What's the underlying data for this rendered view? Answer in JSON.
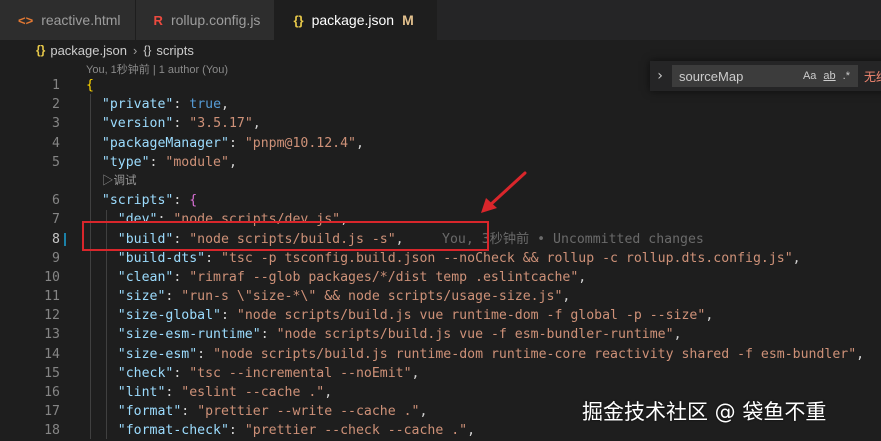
{
  "tabs": [
    {
      "icon": "<>",
      "label": "reactive.html",
      "active": false
    },
    {
      "icon": "R",
      "label": "rollup.config.js",
      "active": false
    },
    {
      "icon": "{}",
      "label": "package.json",
      "modified": "M",
      "active": true
    }
  ],
  "breadcrumb": {
    "file": "package.json",
    "symbol": "scripts",
    "file_icon": "{}",
    "symbol_icon": "{}"
  },
  "blame_header": "You, 1秒钟前 | 1 author (You)",
  "codelens_debug": "▷调试",
  "inline_blame": "You, 3秒钟前 • Uncommitted changes",
  "lines": [
    {
      "n": "1",
      "t": [
        [
          "br",
          "{"
        ]
      ]
    },
    {
      "n": "2",
      "t": [
        [
          "p",
          "  "
        ],
        [
          "k",
          "\"private\""
        ],
        [
          "p",
          ": "
        ],
        [
          "b",
          "true"
        ],
        [
          "p",
          ","
        ]
      ]
    },
    {
      "n": "3",
      "t": [
        [
          "p",
          "  "
        ],
        [
          "k",
          "\"version\""
        ],
        [
          "p",
          ": "
        ],
        [
          "s",
          "\"3.5.17\""
        ],
        [
          "p",
          ","
        ]
      ]
    },
    {
      "n": "4",
      "t": [
        [
          "p",
          "  "
        ],
        [
          "k",
          "\"packageManager\""
        ],
        [
          "p",
          ": "
        ],
        [
          "s",
          "\"pnpm@10.12.4\""
        ],
        [
          "p",
          ","
        ]
      ]
    },
    {
      "n": "5",
      "t": [
        [
          "p",
          "  "
        ],
        [
          "k",
          "\"type\""
        ],
        [
          "p",
          ": "
        ],
        [
          "s",
          "\"module\""
        ],
        [
          "p",
          ","
        ]
      ]
    },
    {
      "lens": true
    },
    {
      "n": "6",
      "t": [
        [
          "p",
          "  "
        ],
        [
          "k",
          "\"scripts\""
        ],
        [
          "p",
          ": "
        ],
        [
          "brp",
          "{"
        ]
      ]
    },
    {
      "n": "7",
      "t": [
        [
          "p",
          "    "
        ],
        [
          "k",
          "\"dev\""
        ],
        [
          "p",
          ": "
        ],
        [
          "s",
          "\"node scripts/dev.js\""
        ],
        [
          "p",
          ","
        ]
      ]
    },
    {
      "n": "8",
      "cur": true,
      "t": [
        [
          "p",
          "    "
        ],
        [
          "k",
          "\"build\""
        ],
        [
          "p",
          ": "
        ],
        [
          "s",
          "\"node scripts/build.js -s\""
        ],
        [
          "p",
          ","
        ]
      ]
    },
    {
      "n": "9",
      "t": [
        [
          "p",
          "    "
        ],
        [
          "k",
          "\"build-dts\""
        ],
        [
          "p",
          ": "
        ],
        [
          "s",
          "\"tsc -p tsconfig.build.json --noCheck && rollup -c rollup.dts.config.js\""
        ],
        [
          "p",
          ","
        ]
      ]
    },
    {
      "n": "10",
      "t": [
        [
          "p",
          "    "
        ],
        [
          "k",
          "\"clean\""
        ],
        [
          "p",
          ": "
        ],
        [
          "s",
          "\"rimraf --glob packages/*/dist temp .eslintcache\""
        ],
        [
          "p",
          ","
        ]
      ]
    },
    {
      "n": "11",
      "t": [
        [
          "p",
          "    "
        ],
        [
          "k",
          "\"size\""
        ],
        [
          "p",
          ": "
        ],
        [
          "s",
          "\"run-s \\\"size-*\\\" && node scripts/usage-size.js\""
        ],
        [
          "p",
          ","
        ]
      ]
    },
    {
      "n": "12",
      "t": [
        [
          "p",
          "    "
        ],
        [
          "k",
          "\"size-global\""
        ],
        [
          "p",
          ": "
        ],
        [
          "s",
          "\"node scripts/build.js vue runtime-dom -f global -p --size\""
        ],
        [
          "p",
          ","
        ]
      ]
    },
    {
      "n": "13",
      "t": [
        [
          "p",
          "    "
        ],
        [
          "k",
          "\"size-esm-runtime\""
        ],
        [
          "p",
          ": "
        ],
        [
          "s",
          "\"node scripts/build.js vue -f esm-bundler-runtime\""
        ],
        [
          "p",
          ","
        ]
      ]
    },
    {
      "n": "14",
      "t": [
        [
          "p",
          "    "
        ],
        [
          "k",
          "\"size-esm\""
        ],
        [
          "p",
          ": "
        ],
        [
          "s",
          "\"node scripts/build.js runtime-dom runtime-core reactivity shared -f esm-bundler\""
        ],
        [
          "p",
          ","
        ]
      ]
    },
    {
      "n": "15",
      "t": [
        [
          "p",
          "    "
        ],
        [
          "k",
          "\"check\""
        ],
        [
          "p",
          ": "
        ],
        [
          "s",
          "\"tsc --incremental --noEmit\""
        ],
        [
          "p",
          ","
        ]
      ]
    },
    {
      "n": "16",
      "t": [
        [
          "p",
          "    "
        ],
        [
          "k",
          "\"lint\""
        ],
        [
          "p",
          ": "
        ],
        [
          "s",
          "\"eslint --cache .\""
        ],
        [
          "p",
          ","
        ]
      ]
    },
    {
      "n": "17",
      "t": [
        [
          "p",
          "    "
        ],
        [
          "k",
          "\"format\""
        ],
        [
          "p",
          ": "
        ],
        [
          "s",
          "\"prettier --write --cache .\""
        ],
        [
          "p",
          ","
        ]
      ]
    },
    {
      "n": "18",
      "t": [
        [
          "p",
          "    "
        ],
        [
          "k",
          "\"format-check\""
        ],
        [
          "p",
          ": "
        ],
        [
          "s",
          "\"prettier --check --cache .\""
        ],
        [
          "p",
          ","
        ]
      ]
    }
  ],
  "find": {
    "value": "sourceMap",
    "case_label": "Aa",
    "word_label": "ab",
    "regex_label": ".*",
    "result": "无结"
  },
  "watermark": "掘金技术社区 @ 袋鱼不重",
  "colors": {
    "accent": "#1b81a8",
    "annotation": "#d9262b",
    "modified": "#e2c08d"
  }
}
